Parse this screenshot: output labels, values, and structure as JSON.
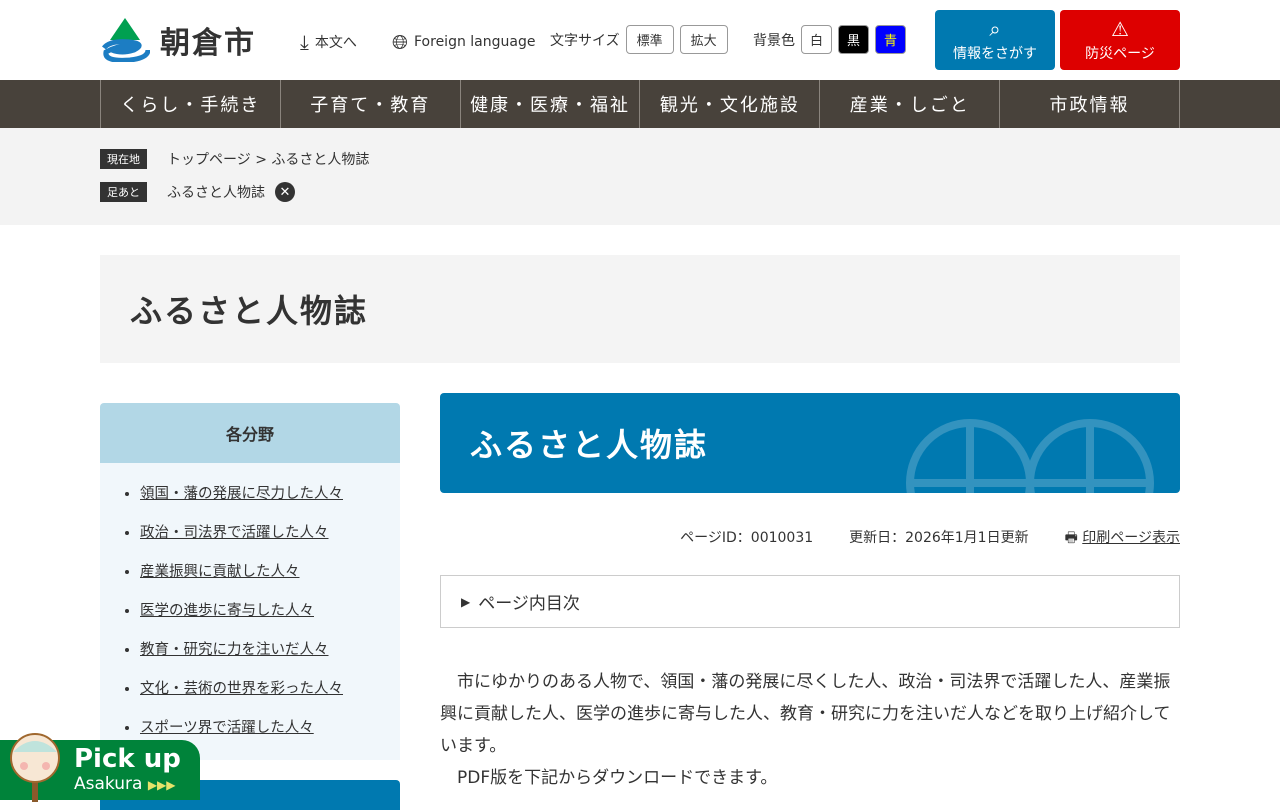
{
  "header": {
    "site_title": "朝倉市",
    "skip": "本文へ",
    "foreign": "Foreign language",
    "font_size_label": "文字サイズ",
    "font_standard": "標準",
    "font_large": "拡大",
    "bg_label": "背景色",
    "bg_white": "白",
    "bg_black": "黒",
    "bg_blue": "青",
    "search_btn": "情報をさがす",
    "disaster_btn": "防災ページ"
  },
  "nav": [
    "くらし・手続き",
    "子育て・教育",
    "健康・医療・福祉",
    "観光・文化施設",
    "産業・しごと",
    "市政情報"
  ],
  "breadcrumb": {
    "current_tag": "現在地",
    "home": "トップページ",
    "sep": ">",
    "current": "ふるさと人物誌",
    "history_tag": "足あと",
    "history_item": "ふるさと人物誌"
  },
  "page_title": "ふるさと人物誌",
  "sidebar": {
    "heading": "各分野",
    "items": [
      "領国・藩の発展に尽力した人々",
      "政治・司法界で活躍した人々",
      "産業振興に貢献した人々",
      "医学の進歩に寄与した人々",
      "教育・研究に力を注いだ人々",
      "文化・芸術の世界を彩った人々",
      "スポーツ界で活躍した人々"
    ]
  },
  "main": {
    "banner_title": "ふるさと人物誌",
    "page_id": "ページID：0010031",
    "updated": "更新日：2026年1月1日更新",
    "print": "印刷ページ表示",
    "toc": "ページ内目次",
    "para1": "市にゆかりのある人物で、領国・藩の発展に尽くした人、政治・司法界で活躍した人、産業振興に貢献した人、医学の進歩に寄与した人、教育・研究に力を注いだ人などを取り上げ紹介しています。",
    "para2": "PDF版を下記からダウンロードできます。"
  },
  "pickup": {
    "line1": "Pick up",
    "line2": "Asakura"
  }
}
